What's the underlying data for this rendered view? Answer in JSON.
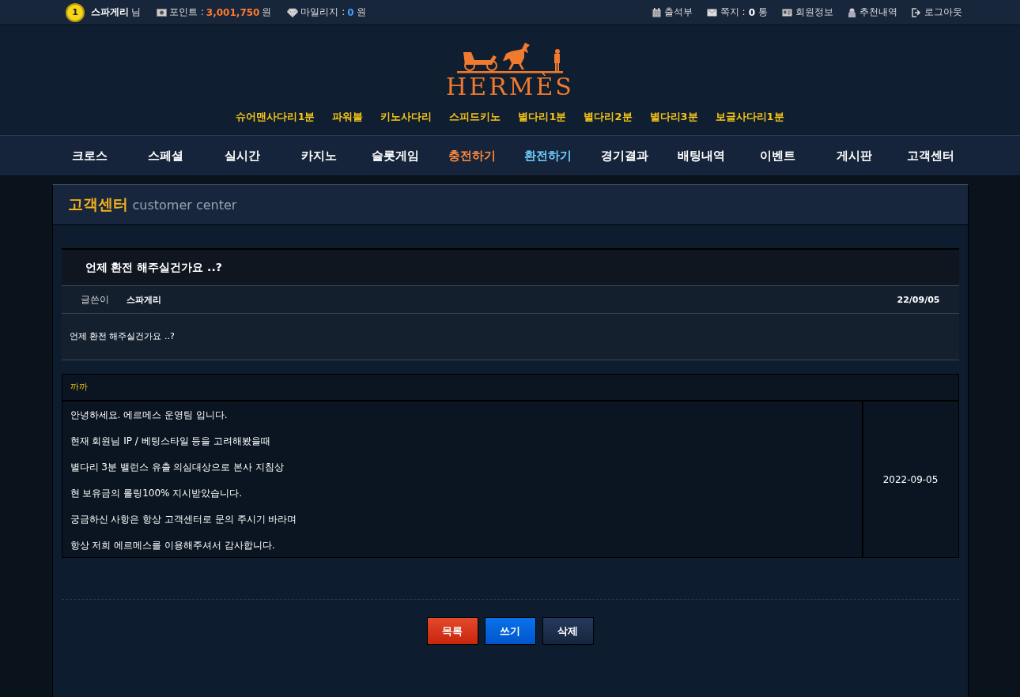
{
  "top_bar": {
    "level": "1",
    "user_name": "스파게리",
    "user_suffix": "님",
    "points_label": "포인트 : ",
    "points_value": "3,001,750",
    "points_unit": "원",
    "mileage_label": "마일리지 : ",
    "mileage_value": "0",
    "mileage_unit": "원",
    "links": [
      {
        "kind": "calendar",
        "label": "출석부"
      },
      {
        "kind": "mail",
        "label": "쪽지 : ",
        "count": "0",
        "unit": " 통"
      },
      {
        "kind": "card",
        "label": "회원정보"
      },
      {
        "kind": "person",
        "label": "추천내역"
      },
      {
        "kind": "logout",
        "label": "로그아웃"
      }
    ]
  },
  "logo": {
    "text": "HERMÈS"
  },
  "game_links": [
    "슈어맨사다리1분",
    "파워볼",
    "키노사다리",
    "스피드키노",
    "별다리1분",
    "별다리2분",
    "별다리3분",
    "보글사다리1분"
  ],
  "main_nav": [
    {
      "label": "크로스",
      "color": "#ffffff"
    },
    {
      "label": "스페셜",
      "color": "#ffffff"
    },
    {
      "label": "실시간",
      "color": "#ffffff"
    },
    {
      "label": "카지노",
      "color": "#ffffff"
    },
    {
      "label": "슬롯게임",
      "color": "#ffffff"
    },
    {
      "label": "충전하기",
      "color": "#ff8a3d"
    },
    {
      "label": "환전하기",
      "color": "#6fd0ff"
    },
    {
      "label": "경기결과",
      "color": "#ffffff"
    },
    {
      "label": "배팅내역",
      "color": "#ffffff"
    },
    {
      "label": "이벤트",
      "color": "#ffffff"
    },
    {
      "label": "게시판",
      "color": "#ffffff"
    },
    {
      "label": "고객센터",
      "color": "#ffffff"
    }
  ],
  "page_title": {
    "main": "고객센터",
    "sub": "customer center"
  },
  "post": {
    "title": "언제 환전 해주실건가요 ..?",
    "author_label": "글쓴이",
    "author": "스파게리",
    "date": "22/09/05",
    "body": "언제 환전 해주실건가요 ..?"
  },
  "reply": {
    "author": "까까",
    "lines": [
      "안녕하세요. 에르메스 운영팀 입니다.",
      "현재 회원님 IP / 베팅스타일 등을 고려해봤을때",
      "별다리 3분 밸런스 유출 의심대상으로 본사 지침상",
      "현 보유금의 롤링100% 지시받았습니다.",
      "궁금하신 사항은 항상 고객센터로 문의 주시기 바라며",
      "항상 저희 에르메스를 이용해주셔서 감사합니다."
    ],
    "date": "2022-09-05"
  },
  "buttons": [
    {
      "kind": "red",
      "label": "목록"
    },
    {
      "kind": "blue",
      "label": "쓰기"
    },
    {
      "kind": "dark",
      "label": "삭제"
    }
  ]
}
